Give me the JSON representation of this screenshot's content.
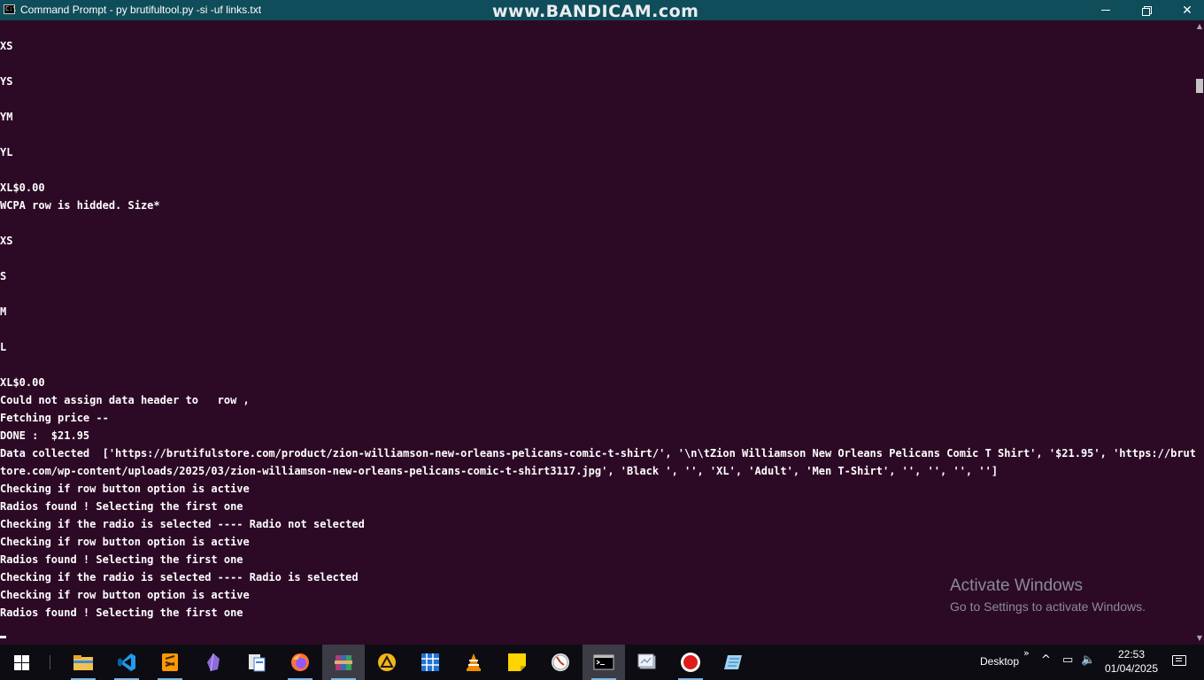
{
  "window": {
    "title": "Command Prompt - py  brutifultool.py -si -uf links.txt",
    "watermark": "www.BANDICAM.com",
    "icon": "cmd-icon"
  },
  "console": {
    "lines": [
      "XS",
      "",
      "YS",
      "",
      "YM",
      "",
      "YL",
      "",
      "XL$0.00",
      "WCPA row is hidded. Size*",
      "",
      "XS",
      "",
      "S",
      "",
      "M",
      "",
      "L",
      "",
      "XL$0.00",
      "Could not assign data header to   row ,",
      "Fetching price --",
      "DONE :  $21.95",
      "Data collected  ['https://brutifulstore.com/product/zion-williamson-new-orleans-pelicans-comic-t-shirt/', '\\n\\tZion Williamson New Orleans Pelicans Comic T Shirt', '$21.95', 'https://brutifuls",
      "tore.com/wp-content/uploads/2025/03/zion-williamson-new-orleans-pelicans-comic-t-shirt3117.jpg', 'Black ', '', 'XL', 'Adult', 'Men T-Shirt', '', '', '', '']",
      "Checking if row button option is active",
      "Radios found ! Selecting the first one",
      "Checking if the radio is selected ---- Radio not selected",
      "Checking if row button option is active",
      "Radios found ! Selecting the first one",
      "Checking if the radio is selected ---- Radio is selected",
      "Checking if row button option is active",
      "Radios found ! Selecting the first one"
    ]
  },
  "activation": {
    "title": "Activate Windows",
    "subtitle": "Go to Settings to activate Windows."
  },
  "taskbar": {
    "apps": [
      "file-explorer-icon",
      "vscode-icon",
      "sublime-text-icon",
      "obsidian-icon",
      "file-manager-icon",
      "firefox-icon",
      "winrar-icon",
      "app-triangle-icon",
      "grid-app-icon",
      "vlc-icon",
      "sticky-notes-icon",
      "clock-app-icon",
      "command-prompt-icon",
      "screenshot-tool-icon",
      "bandicam-record-icon",
      "notepad-icon"
    ],
    "desktop_label": "Desktop",
    "clock_time": "22:53",
    "clock_date": "01/04/2025"
  },
  "colors": {
    "console_bg": "#2c0a26",
    "titlebar_bg": "#0f4d5a",
    "taskbar_bg": "#0c0c12"
  }
}
